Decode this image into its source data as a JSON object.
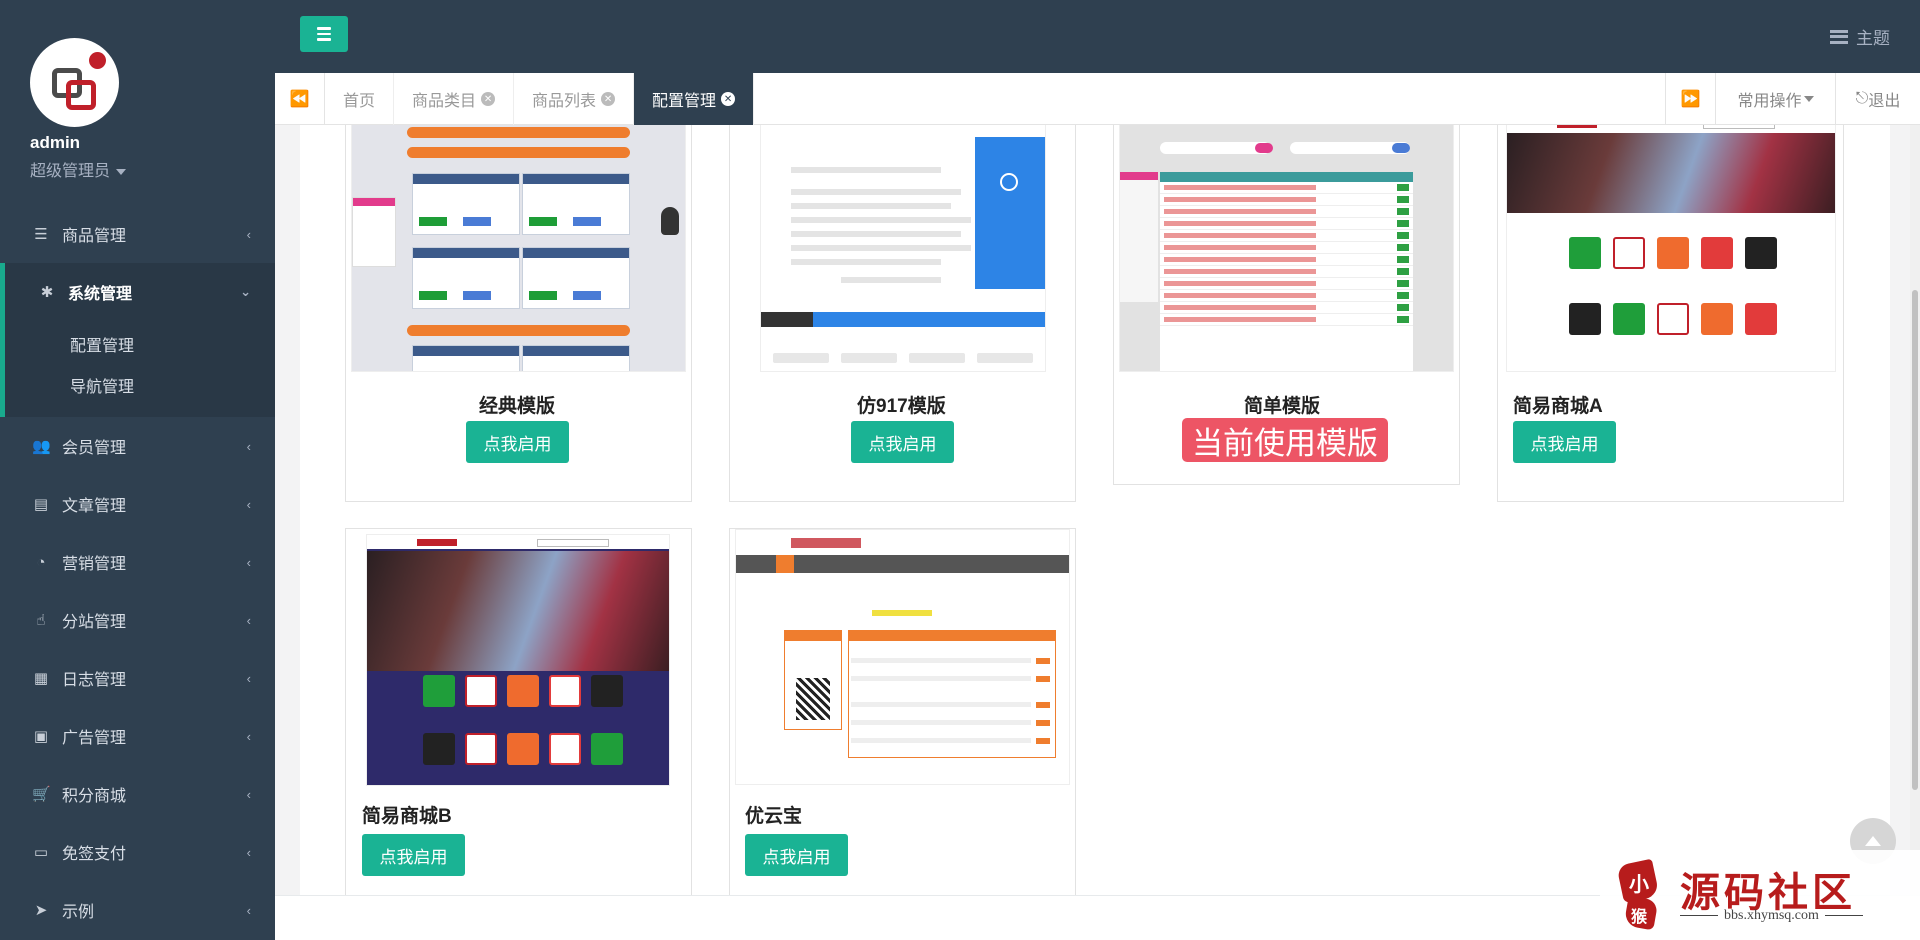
{
  "profile": {
    "username": "admin",
    "role": "超级管理员"
  },
  "sidebar": {
    "items": [
      {
        "label": "商品管理",
        "icon": "bars-icon"
      },
      {
        "label": "系统管理",
        "icon": "gear-icon",
        "expanded": true,
        "children": [
          {
            "label": "配置管理"
          },
          {
            "label": "导航管理"
          }
        ]
      },
      {
        "label": "会员管理",
        "icon": "users-icon"
      },
      {
        "label": "文章管理",
        "icon": "files-icon"
      },
      {
        "label": "营销管理",
        "icon": "pie-chart-icon"
      },
      {
        "label": "分站管理",
        "icon": "hand-icon"
      },
      {
        "label": "日志管理",
        "icon": "list-icon"
      },
      {
        "label": "广告管理",
        "icon": "image-icon"
      },
      {
        "label": "积分商城",
        "icon": "cart-icon"
      },
      {
        "label": "免签支付",
        "icon": "credit-card-icon"
      },
      {
        "label": "示例",
        "icon": "paper-plane-icon"
      }
    ]
  },
  "topbar": {
    "theme_label": "主题"
  },
  "tabs": {
    "items": [
      {
        "label": "首页",
        "closable": false,
        "active": false
      },
      {
        "label": "商品类目",
        "closable": true,
        "active": false
      },
      {
        "label": "商品列表",
        "closable": true,
        "active": false
      },
      {
        "label": "配置管理",
        "closable": true,
        "active": true
      }
    ],
    "ops_label": "常用操作",
    "logout_label": "退出"
  },
  "templates": [
    {
      "name": "经典模版",
      "action": "点我启用"
    },
    {
      "name": "仿917模版",
      "action": "点我启用"
    },
    {
      "name": "简单模版",
      "status": "当前使用模版"
    },
    {
      "name": "简易商城A",
      "action": "点我启用"
    },
    {
      "name": "简易商城B",
      "action": "点我启用"
    },
    {
      "name": "优云宝",
      "action": "点我启用"
    }
  ],
  "watermark": {
    "seal_top": "小",
    "seal_bottom": "猴",
    "title": "源码社区",
    "url": "bbs.xhymsq.com"
  },
  "colors": {
    "sidebar_bg": "#2f4050",
    "accent": "#1ab394",
    "danger": "#ed5565"
  }
}
